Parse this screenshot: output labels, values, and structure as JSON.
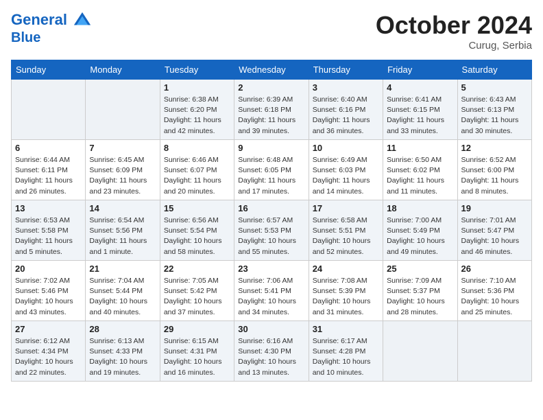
{
  "header": {
    "logo_line1": "General",
    "logo_line2": "Blue",
    "month": "October 2024",
    "location": "Curug, Serbia"
  },
  "weekdays": [
    "Sunday",
    "Monday",
    "Tuesday",
    "Wednesday",
    "Thursday",
    "Friday",
    "Saturday"
  ],
  "weeks": [
    [
      {
        "day": "",
        "info": ""
      },
      {
        "day": "",
        "info": ""
      },
      {
        "day": "1",
        "info": "Sunrise: 6:38 AM\nSunset: 6:20 PM\nDaylight: 11 hours\nand 42 minutes."
      },
      {
        "day": "2",
        "info": "Sunrise: 6:39 AM\nSunset: 6:18 PM\nDaylight: 11 hours\nand 39 minutes."
      },
      {
        "day": "3",
        "info": "Sunrise: 6:40 AM\nSunset: 6:16 PM\nDaylight: 11 hours\nand 36 minutes."
      },
      {
        "day": "4",
        "info": "Sunrise: 6:41 AM\nSunset: 6:15 PM\nDaylight: 11 hours\nand 33 minutes."
      },
      {
        "day": "5",
        "info": "Sunrise: 6:43 AM\nSunset: 6:13 PM\nDaylight: 11 hours\nand 30 minutes."
      }
    ],
    [
      {
        "day": "6",
        "info": "Sunrise: 6:44 AM\nSunset: 6:11 PM\nDaylight: 11 hours\nand 26 minutes."
      },
      {
        "day": "7",
        "info": "Sunrise: 6:45 AM\nSunset: 6:09 PM\nDaylight: 11 hours\nand 23 minutes."
      },
      {
        "day": "8",
        "info": "Sunrise: 6:46 AM\nSunset: 6:07 PM\nDaylight: 11 hours\nand 20 minutes."
      },
      {
        "day": "9",
        "info": "Sunrise: 6:48 AM\nSunset: 6:05 PM\nDaylight: 11 hours\nand 17 minutes."
      },
      {
        "day": "10",
        "info": "Sunrise: 6:49 AM\nSunset: 6:03 PM\nDaylight: 11 hours\nand 14 minutes."
      },
      {
        "day": "11",
        "info": "Sunrise: 6:50 AM\nSunset: 6:02 PM\nDaylight: 11 hours\nand 11 minutes."
      },
      {
        "day": "12",
        "info": "Sunrise: 6:52 AM\nSunset: 6:00 PM\nDaylight: 11 hours\nand 8 minutes."
      }
    ],
    [
      {
        "day": "13",
        "info": "Sunrise: 6:53 AM\nSunset: 5:58 PM\nDaylight: 11 hours\nand 5 minutes."
      },
      {
        "day": "14",
        "info": "Sunrise: 6:54 AM\nSunset: 5:56 PM\nDaylight: 11 hours\nand 1 minute."
      },
      {
        "day": "15",
        "info": "Sunrise: 6:56 AM\nSunset: 5:54 PM\nDaylight: 10 hours\nand 58 minutes."
      },
      {
        "day": "16",
        "info": "Sunrise: 6:57 AM\nSunset: 5:53 PM\nDaylight: 10 hours\nand 55 minutes."
      },
      {
        "day": "17",
        "info": "Sunrise: 6:58 AM\nSunset: 5:51 PM\nDaylight: 10 hours\nand 52 minutes."
      },
      {
        "day": "18",
        "info": "Sunrise: 7:00 AM\nSunset: 5:49 PM\nDaylight: 10 hours\nand 49 minutes."
      },
      {
        "day": "19",
        "info": "Sunrise: 7:01 AM\nSunset: 5:47 PM\nDaylight: 10 hours\nand 46 minutes."
      }
    ],
    [
      {
        "day": "20",
        "info": "Sunrise: 7:02 AM\nSunset: 5:46 PM\nDaylight: 10 hours\nand 43 minutes."
      },
      {
        "day": "21",
        "info": "Sunrise: 7:04 AM\nSunset: 5:44 PM\nDaylight: 10 hours\nand 40 minutes."
      },
      {
        "day": "22",
        "info": "Sunrise: 7:05 AM\nSunset: 5:42 PM\nDaylight: 10 hours\nand 37 minutes."
      },
      {
        "day": "23",
        "info": "Sunrise: 7:06 AM\nSunset: 5:41 PM\nDaylight: 10 hours\nand 34 minutes."
      },
      {
        "day": "24",
        "info": "Sunrise: 7:08 AM\nSunset: 5:39 PM\nDaylight: 10 hours\nand 31 minutes."
      },
      {
        "day": "25",
        "info": "Sunrise: 7:09 AM\nSunset: 5:37 PM\nDaylight: 10 hours\nand 28 minutes."
      },
      {
        "day": "26",
        "info": "Sunrise: 7:10 AM\nSunset: 5:36 PM\nDaylight: 10 hours\nand 25 minutes."
      }
    ],
    [
      {
        "day": "27",
        "info": "Sunrise: 6:12 AM\nSunset: 4:34 PM\nDaylight: 10 hours\nand 22 minutes."
      },
      {
        "day": "28",
        "info": "Sunrise: 6:13 AM\nSunset: 4:33 PM\nDaylight: 10 hours\nand 19 minutes."
      },
      {
        "day": "29",
        "info": "Sunrise: 6:15 AM\nSunset: 4:31 PM\nDaylight: 10 hours\nand 16 minutes."
      },
      {
        "day": "30",
        "info": "Sunrise: 6:16 AM\nSunset: 4:30 PM\nDaylight: 10 hours\nand 13 minutes."
      },
      {
        "day": "31",
        "info": "Sunrise: 6:17 AM\nSunset: 4:28 PM\nDaylight: 10 hours\nand 10 minutes."
      },
      {
        "day": "",
        "info": ""
      },
      {
        "day": "",
        "info": ""
      }
    ]
  ]
}
